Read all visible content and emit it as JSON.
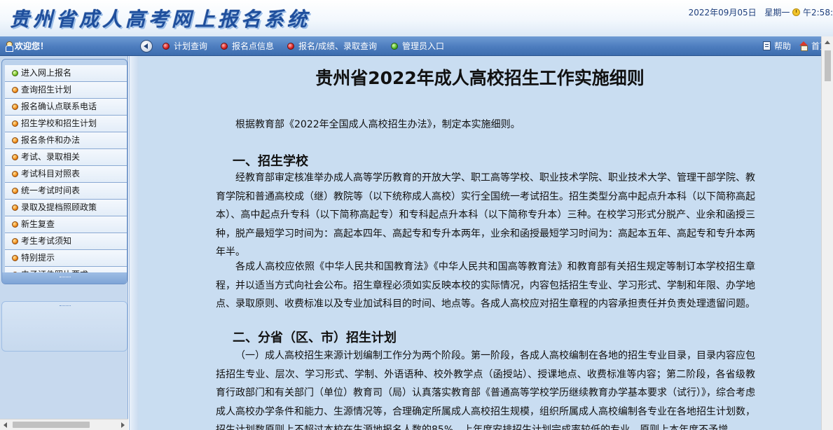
{
  "header": {
    "title": "贵州省成人高考网上报名系统",
    "date": "2022年09月05日",
    "weekday": "星期一",
    "time": "午2:58:"
  },
  "nav": {
    "welcome": "欢迎您！",
    "links": [
      "计划查询",
      "报名点信息",
      "报名/成绩、录取查询",
      "管理员入口"
    ],
    "help": "帮助",
    "home": "首页"
  },
  "sidebar": {
    "items": [
      {
        "label": "进入网上报名",
        "icon": "green-dot-icon"
      },
      {
        "label": "查询招生计划",
        "icon": "orange-dot-icon"
      },
      {
        "label": "报名确认点联系电话",
        "icon": "orange-dot-icon"
      },
      {
        "label": "招生学校和招生计划",
        "icon": "orange-dot-icon"
      },
      {
        "label": "报名条件和办法",
        "icon": "orange-dot-icon"
      },
      {
        "label": "考试、录取相关",
        "icon": "orange-dot-icon"
      },
      {
        "label": "考试科目对照表",
        "icon": "orange-dot-icon"
      },
      {
        "label": "统一考试时间表",
        "icon": "orange-dot-icon"
      },
      {
        "label": "录取及提档照顾政策",
        "icon": "orange-dot-icon"
      },
      {
        "label": "新生复查",
        "icon": "orange-dot-icon"
      },
      {
        "label": "考生考试须知",
        "icon": "orange-dot-icon"
      },
      {
        "label": "特别提示",
        "icon": "orange-dot-icon"
      },
      {
        "label": "电子证件照片要求",
        "icon": "orange-dot-icon"
      }
    ]
  },
  "document": {
    "title": "贵州省2022年成人高校招生工作实施细则",
    "intro": "根据教育部《2022年全国成人高校招生办法》，制定本实施细则。",
    "section1_heading": "一、招生学校",
    "section1_p1": "经教育部审定核准举办成人高等学历教育的开放大学、职工高等学校、职业技术学院、职业技术大学、管理干部学院、教育学院和普通高校成（继）教院等（以下统称成人高校）实行全国统一考试招生。招生类型分高中起点升本科（以下简称高起本）、高中起点升专科（以下简称高起专）和专科起点升本科（以下简称专升本）三种。在校学习形式分脱产、业余和函授三种，脱产最短学习时间为：高起本四年、高起专和专升本两年，业余和函授最短学习时间为：高起本五年、高起专和专升本两年半。",
    "section1_p2": "各成人高校应依照《中华人民共和国教育法》《中华人民共和国高等教育法》和教育部有关招生规定等制订本学校招生章程，并以适当方式向社会公布。招生章程必须如实反映本校的实际情况，内容包括招生专业、学习形式、学制和年限、办学地点、录取原则、收费标准以及专业加试科目的时间、地点等。各成人高校应对招生章程的内容承担责任并负责处理遗留问题。",
    "section2_heading": "二、分省（区、市）招生计划",
    "section2_p1": "（一）成人高校招生来源计划编制工作分为两个阶段。第一阶段，各成人高校编制在各地的招生专业目录，目录内容应包括招生专业、层次、学习形式、学制、外语语种、校外教学点（函授站）、授课地点、收费标准等内容；第二阶段，各省级教育行政部门和有关部门（单位）教育司（局）认真落实教育部《普通高等学校学历继续教育办学基本要求（试行）》，综合考虑成人高校办学条件和能力、生源情况等，合理确定所属成人高校招生规模，组织所属成人高校编制各专业在各地招生计划数，招生计划数原则上不超过本校在生源地报名人数的85%。上年度安排招生计划完成率较低的专业，原则上本年度不予增"
  }
}
